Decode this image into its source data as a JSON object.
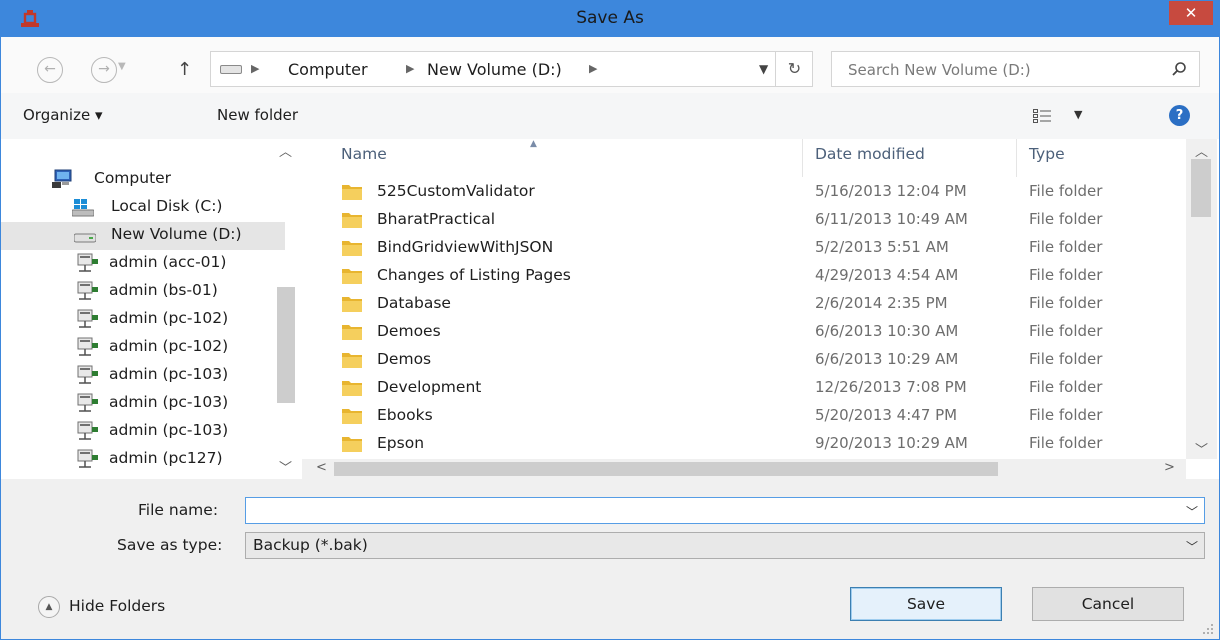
{
  "window": {
    "title": "Save As",
    "close_glyph": "✕"
  },
  "address": {
    "crumbs": [
      "Computer",
      "New Volume (D:)"
    ],
    "search_placeholder": "Search New Volume (D:)"
  },
  "toolbar": {
    "organize_label": "Organize ▾",
    "new_folder_label": "New folder",
    "help_glyph": "?"
  },
  "navigation": {
    "items": [
      {
        "label": "Computer",
        "icon": "computer-icon"
      },
      {
        "label": "Local Disk (C:)",
        "icon": "windows-drive-icon"
      },
      {
        "label": "New Volume (D:)",
        "icon": "drive-icon",
        "selected": true
      },
      {
        "label": "admin (acc-01)",
        "icon": "network-drive-icon"
      },
      {
        "label": "admin (bs-01)",
        "icon": "network-drive-icon"
      },
      {
        "label": "admin (pc-102)",
        "icon": "network-drive-icon"
      },
      {
        "label": "admin (pc-102)",
        "icon": "network-drive-icon"
      },
      {
        "label": "admin (pc-103)",
        "icon": "network-drive-icon"
      },
      {
        "label": "admin (pc-103)",
        "icon": "network-drive-icon"
      },
      {
        "label": "admin (pc-103)",
        "icon": "network-drive-icon"
      },
      {
        "label": "admin (pc127)",
        "icon": "network-drive-icon"
      }
    ]
  },
  "filelist": {
    "columns": [
      "Name",
      "Date modified",
      "Type"
    ],
    "rows": [
      {
        "name": "525CustomValidator",
        "date": "5/16/2013 12:04 PM",
        "type": "File folder"
      },
      {
        "name": "BharatPractical",
        "date": "6/11/2013 10:49 AM",
        "type": "File folder"
      },
      {
        "name": "BindGridviewWithJSON",
        "date": "5/2/2013 5:51 AM",
        "type": "File folder"
      },
      {
        "name": "Changes of Listing Pages",
        "date": "4/29/2013 4:54 AM",
        "type": "File folder"
      },
      {
        "name": "Database",
        "date": "2/6/2014 2:35 PM",
        "type": "File folder"
      },
      {
        "name": "Demoes",
        "date": "6/6/2013 10:30 AM",
        "type": "File folder"
      },
      {
        "name": "Demos",
        "date": "6/6/2013 10:29 AM",
        "type": "File folder"
      },
      {
        "name": "Development",
        "date": "12/26/2013 7:08 PM",
        "type": "File folder"
      },
      {
        "name": "Ebooks",
        "date": "5/20/2013 4:47 PM",
        "type": "File folder"
      },
      {
        "name": "Epson",
        "date": "9/20/2013 10:29 AM",
        "type": "File folder"
      }
    ]
  },
  "form": {
    "file_name_label": "File name:",
    "file_name_value": "",
    "save_type_label": "Save as type:",
    "save_type_value": "Backup (*.bak)"
  },
  "footer": {
    "hide_folders_label": "Hide Folders",
    "save_label": "Save",
    "cancel_label": "Cancel"
  },
  "colors": {
    "titlebar": "#3d87dc",
    "close_button": "#c74a3f",
    "folder": "#e8b530",
    "selection": "#e5e5e5"
  }
}
